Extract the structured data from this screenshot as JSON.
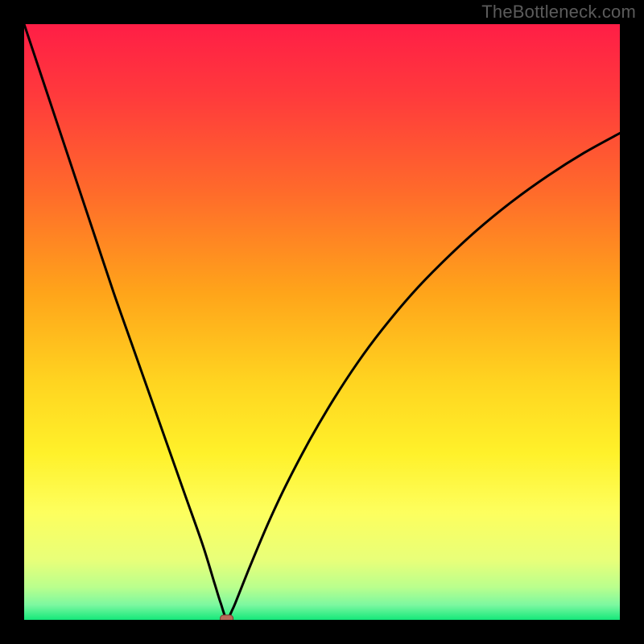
{
  "watermark": "TheBottleneck.com",
  "colors": {
    "frame_bg": "#000000",
    "curve": "#000000",
    "marker_fill": "#b86a5a",
    "gradient_stops": [
      {
        "offset": 0.0,
        "color": "#ff1e46"
      },
      {
        "offset": 0.12,
        "color": "#ff3a3c"
      },
      {
        "offset": 0.28,
        "color": "#ff6a2b"
      },
      {
        "offset": 0.45,
        "color": "#ffa41a"
      },
      {
        "offset": 0.6,
        "color": "#ffd420"
      },
      {
        "offset": 0.72,
        "color": "#fff12a"
      },
      {
        "offset": 0.82,
        "color": "#fdff5e"
      },
      {
        "offset": 0.9,
        "color": "#e8ff79"
      },
      {
        "offset": 0.945,
        "color": "#baff8d"
      },
      {
        "offset": 0.975,
        "color": "#7cf8a0"
      },
      {
        "offset": 1.0,
        "color": "#15e87a"
      }
    ]
  },
  "chart_data": {
    "type": "line",
    "title": "",
    "xlabel": "",
    "ylabel": "",
    "x_range": [
      0,
      100
    ],
    "y_range": [
      0,
      100
    ],
    "minimum_point": {
      "x": 34,
      "y": 0
    },
    "series": [
      {
        "name": "bottleneck-curve",
        "x": [
          0,
          3,
          6,
          9,
          12,
          15,
          18,
          21,
          24,
          27,
          30,
          32,
          33,
          34,
          35,
          36,
          38,
          41,
          44,
          48,
          52,
          56,
          60,
          65,
          70,
          76,
          82,
          88,
          94,
          100
        ],
        "y": [
          100,
          91,
          82,
          73,
          64,
          55,
          46.5,
          38,
          29.5,
          21,
          12.5,
          6,
          2.8,
          0.2,
          1.8,
          4.2,
          9.2,
          16.3,
          22.7,
          30.3,
          37.1,
          43.2,
          48.6,
          54.6,
          59.8,
          65.4,
          70.3,
          74.6,
          78.4,
          81.7
        ]
      }
    ],
    "marker": {
      "x": 34,
      "y": 0
    }
  }
}
